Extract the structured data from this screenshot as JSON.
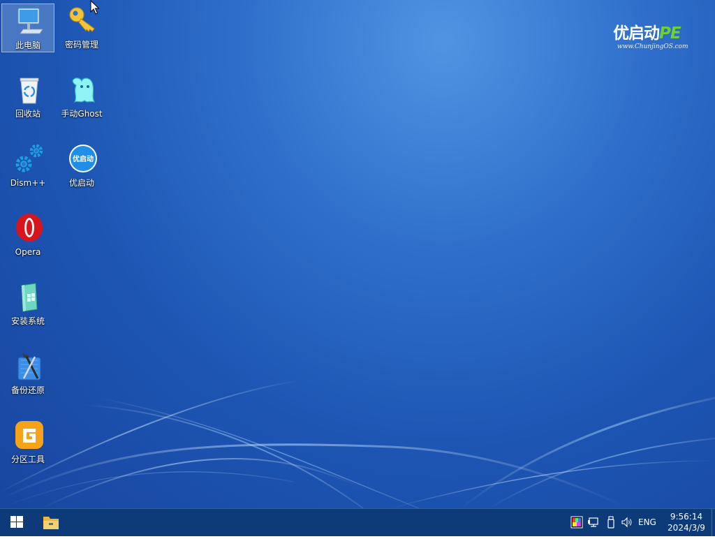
{
  "brand": {
    "name": "优启动",
    "suffix": "PE",
    "url": "www.ChunjingOS.com"
  },
  "desktop_icons": [
    {
      "label": "此电脑",
      "icon": "computer-icon",
      "selected": true
    },
    {
      "label": "密码管理",
      "icon": "key-icon"
    },
    {
      "label": "回收站",
      "icon": "recycle-bin-icon"
    },
    {
      "label": "手动Ghost",
      "icon": "ghost-icon"
    },
    {
      "label": "Dism++",
      "icon": "gears-icon"
    },
    {
      "label": "优启动",
      "icon": "youqidong-logo-icon",
      "badge": "优启动"
    },
    {
      "label": "Opera",
      "icon": "opera-icon"
    },
    {
      "label": "安装系统",
      "icon": "install-system-icon"
    },
    {
      "label": "备份还原",
      "icon": "backup-restore-icon"
    },
    {
      "label": "分区工具",
      "icon": "partition-tool-icon"
    }
  ],
  "taskbar": {
    "tray": {
      "icons": [
        "color-display-icon",
        "network-icon",
        "usb-drive-icon",
        "volume-icon"
      ],
      "language": "ENG"
    },
    "clock": {
      "time": "9:56:14",
      "date": "2024/3/9"
    }
  },
  "colors": {
    "taskbar": "#0d3a78",
    "desktop": "#2f6fcb",
    "brand_accent": "#6fcf3a"
  }
}
